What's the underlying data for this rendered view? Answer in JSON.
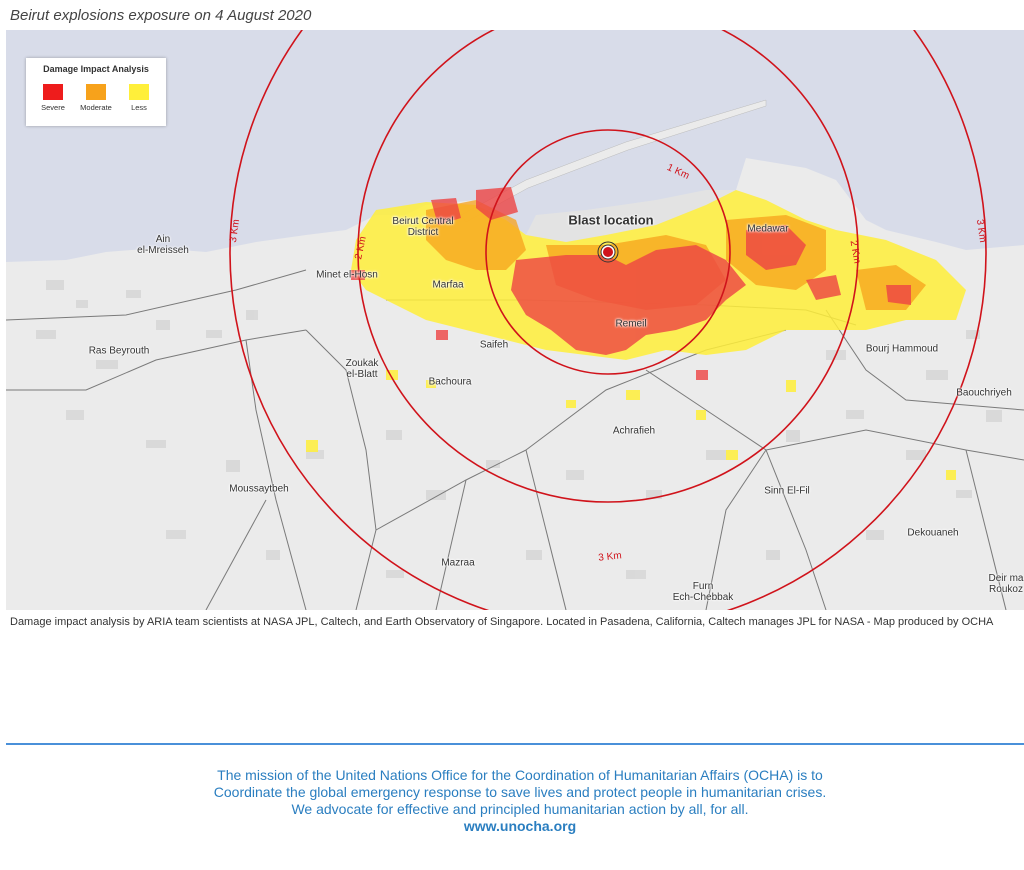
{
  "title": "Beirut explosions exposure on 4 August 2020",
  "legend": {
    "title": "Damage Impact Analysis",
    "items": [
      {
        "label": "Severe",
        "color": "#ee1c1c"
      },
      {
        "label": "Moderate",
        "color": "#f7a21b"
      },
      {
        "label": "Less",
        "color": "#ffef3a"
      }
    ]
  },
  "blast_label": "Blast location",
  "ring_labels": {
    "one_km": "1 Km",
    "two_km_left": "2 Km",
    "two_km_right": "2 Km",
    "three_km_left": "3 Km",
    "three_km_right": "3 Km",
    "three_km_bottom": "3 Km"
  },
  "places": {
    "ain_el_mreisseh": "Ain\nel-Mreisseh",
    "beirut_central_district": "Beirut Central\nDistrict",
    "minet_el_hosn": "Minet el-Hosn",
    "marfaa": "Marfaa",
    "ras_beyrouth": "Ras Beyrouth",
    "zoukak_el_blatt": "Zoukak\nel-Blatt",
    "saifeh": "Saifeh",
    "bachoura": "Bachoura",
    "remeil": "Remeil",
    "medawar": "Medawar",
    "bourj_hammoud": "Bourj Hammoud",
    "baouchriyeh": "Baouchriyeh",
    "achrafieh": "Achrafieh",
    "moussaytbeh": "Moussaytbeh",
    "sinn_el_fil": "Sinn El-Fil",
    "dekouaneh": "Dekouaneh",
    "mazraa": "Mazraa",
    "furn_ech_chebbak": "Furn\nEch-Chebbak",
    "deir_roukoz": "Deir ma\nRoukoz"
  },
  "caption": "Damage impact analysis by ARIA team scientists at NASA JPL, Caltech, and Earth Observatory of Singapore. Located in Pasadena, California, Caltech manages JPL for NASA - Map produced by OCHA",
  "footer": {
    "line1": "The mission of the United Nations Office for the Coordination of Humanitarian Affairs (OCHA) is to",
    "line2": "Coordinate the global emergency response to save lives and protect people in humanitarian crises.",
    "line3": "We advocate for effective and principled humanitarian action by all, for all.",
    "url": "www.unocha.org"
  },
  "colors": {
    "sea": "#d8dce9",
    "land": "#ebebeb",
    "rings": "#d0131b",
    "footer_text": "#2a7ec0"
  }
}
